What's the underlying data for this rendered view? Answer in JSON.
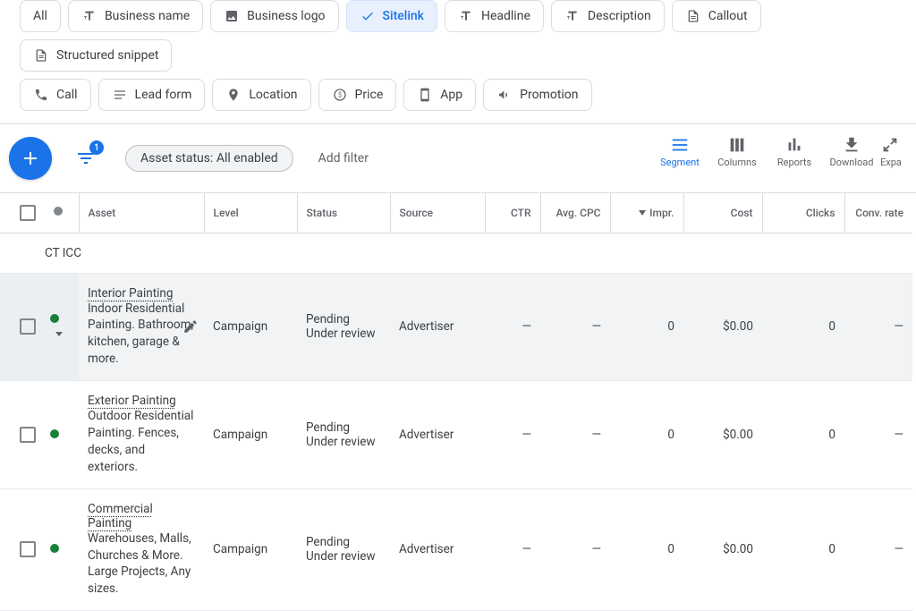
{
  "chips": {
    "row1": [
      {
        "label": "All",
        "icon": "",
        "active": false
      },
      {
        "label": "Business name",
        "icon": "text",
        "active": false
      },
      {
        "label": "Business logo",
        "icon": "image",
        "active": false
      },
      {
        "label": "Sitelink",
        "icon": "check",
        "active": true
      },
      {
        "label": "Headline",
        "icon": "text",
        "active": false
      },
      {
        "label": "Description",
        "icon": "text",
        "active": false
      },
      {
        "label": "Callout",
        "icon": "doc",
        "active": false
      },
      {
        "label": "Structured snippet",
        "icon": "doc",
        "active": false
      }
    ],
    "row2": [
      {
        "label": "Call",
        "icon": "call",
        "active": false
      },
      {
        "label": "Lead form",
        "icon": "form",
        "active": false
      },
      {
        "label": "Location",
        "icon": "pin",
        "active": false
      },
      {
        "label": "Price",
        "icon": "price",
        "active": false
      },
      {
        "label": "App",
        "icon": "app",
        "active": false
      },
      {
        "label": "Promotion",
        "icon": "promo",
        "active": false
      }
    ]
  },
  "toolbar": {
    "status_chip": "Asset status: All enabled",
    "add_filter": "Add filter",
    "filter_badge": "1",
    "tools": {
      "segment": "Segment",
      "columns": "Columns",
      "reports": "Reports",
      "download": "Download",
      "expand": "Expa"
    }
  },
  "table": {
    "headers": {
      "asset": "Asset",
      "level": "Level",
      "status": "Status",
      "source": "Source",
      "ctr": "CTR",
      "avg_cpc": "Avg. CPC",
      "impr": "Impr.",
      "cost": "Cost",
      "clicks": "Clicks",
      "conv_rate": "Conv. rate"
    },
    "group_label": "CT ICC",
    "rows": [
      {
        "hover": true,
        "title": "Interior Painting",
        "desc": "Indoor Residential Painting. Bathroom, kitchen, garage & more.",
        "level": "Campaign",
        "status_l1": "Pending",
        "status_l2": "Under review",
        "source": "Advertiser",
        "ctr": "—",
        "avg_cpc": "—",
        "impr": "0",
        "cost": "$0.00",
        "clicks": "0",
        "conv_rate": "—",
        "show_pencil": true,
        "show_chev": true
      },
      {
        "hover": false,
        "title": "Exterior Painting",
        "desc": "Outdoor Residential Painting. Fences, decks, and exteriors.",
        "level": "Campaign",
        "status_l1": "Pending",
        "status_l2": "Under review",
        "source": "Advertiser",
        "ctr": "—",
        "avg_cpc": "—",
        "impr": "0",
        "cost": "$0.00",
        "clicks": "0",
        "conv_rate": "—",
        "show_pencil": false,
        "show_chev": false
      },
      {
        "hover": false,
        "title": "Commercial Painting",
        "desc": "Warehouses, Malls, Churches & More. Large Projects, Any sizes.",
        "level": "Campaign",
        "status_l1": "Pending",
        "status_l2": "Under review",
        "source": "Advertiser",
        "ctr": "—",
        "avg_cpc": "—",
        "impr": "0",
        "cost": "$0.00",
        "clicks": "0",
        "conv_rate": "—",
        "show_pencil": false,
        "show_chev": false
      }
    ]
  }
}
